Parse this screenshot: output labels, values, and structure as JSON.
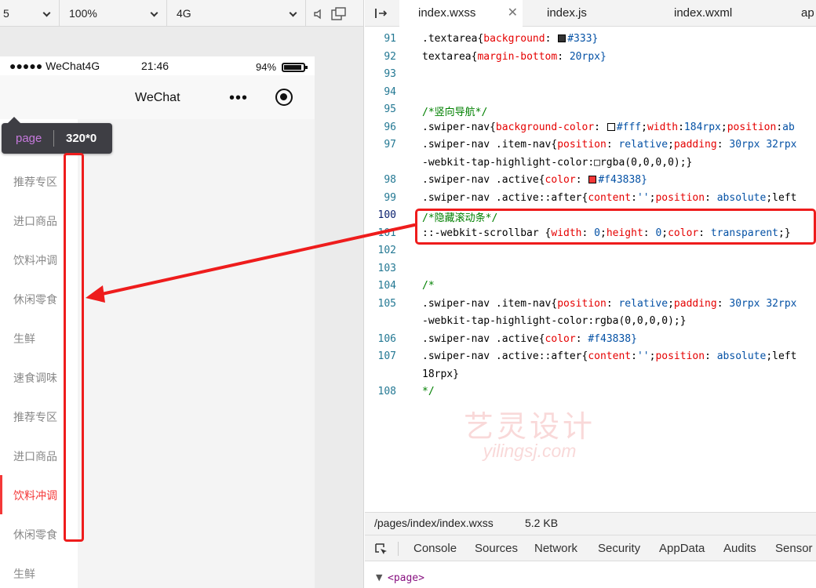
{
  "simulator": {
    "toolbar": {
      "device_value": "5",
      "zoom_value": "100%",
      "network_value": "4G"
    },
    "status_bar": {
      "carrier": "●●●●● WeChat4G",
      "time": "21:46",
      "battery": "94%"
    },
    "navbar": {
      "title": "WeChat",
      "more_glyph": "•••"
    },
    "tooltip": {
      "element": "page",
      "size": "320*0"
    },
    "sidebar": {
      "items": [
        {
          "label": "推荐专区",
          "active": false
        },
        {
          "label": "进口商品",
          "active": false
        },
        {
          "label": "饮料冲调",
          "active": false
        },
        {
          "label": "休闲零食",
          "active": false
        },
        {
          "label": "生鲜",
          "active": false
        },
        {
          "label": "速食调味",
          "active": false
        },
        {
          "label": "推荐专区",
          "active": false
        },
        {
          "label": "进口商品",
          "active": false
        },
        {
          "label": "饮料冲调",
          "active": true
        },
        {
          "label": "休闲零食",
          "active": false
        },
        {
          "label": "生鲜",
          "active": false
        }
      ],
      "active_color": "#f43838"
    }
  },
  "editor": {
    "tabs": [
      {
        "label": "index.wxss",
        "active": true,
        "closable": true
      },
      {
        "label": "index.js",
        "active": false
      },
      {
        "label": "index.wxml",
        "active": false
      },
      {
        "label": "ap",
        "active": false
      }
    ],
    "current_line": "100",
    "code_lines": [
      {
        "n": "91",
        "text": ".textarea{background: ■#333}"
      },
      {
        "n": "92",
        "text": "textarea{margin-bottom: 20rpx}"
      },
      {
        "n": "93",
        "text": ""
      },
      {
        "n": "94",
        "text": ""
      },
      {
        "n": "95",
        "text": "/*竖向导航*/"
      },
      {
        "n": "96",
        "text": ".swiper-nav{background-color: □#fff;width:184rpx;position:ab"
      },
      {
        "n": "97",
        "text": ".swiper-nav .item-nav{position: relative;padding: 30rpx 32rpx"
      },
      {
        "n": "",
        "text": "-webkit-tap-highlight-color:□rgba(0,0,0,0);}"
      },
      {
        "n": "98",
        "text": ".swiper-nav .active{color: ■#f43838}"
      },
      {
        "n": "99",
        "text": ".swiper-nav .active::after{content:'';position: absolute;left"
      },
      {
        "n": "100",
        "text": "/*隐藏滚动条*/"
      },
      {
        "n": "101",
        "text": "::-webkit-scrollbar {width: 0;height: 0;color: transparent;}"
      },
      {
        "n": "102",
        "text": ""
      },
      {
        "n": "103",
        "text": ""
      },
      {
        "n": "104",
        "text": "/*"
      },
      {
        "n": "105",
        "text": ".swiper-nav .item-nav{position: relative;padding: 30rpx 32rpx"
      },
      {
        "n": "",
        "text": "-webkit-tap-highlight-color:rgba(0,0,0,0);}"
      },
      {
        "n": "106",
        "text": ".swiper-nav .active{color: #f43838}"
      },
      {
        "n": "107",
        "text": ".swiper-nav .active::after{content:'';position: absolute;left"
      },
      {
        "n": "",
        "text": "18rpx}"
      },
      {
        "n": "108",
        "text": "*/"
      }
    ],
    "swatches": {
      "dark": "#333333",
      "white": "#ffffff",
      "red": "#f43838"
    },
    "watermark": {
      "line1": "艺灵设计",
      "line2": "yilingsj.com"
    },
    "file_info": {
      "path": "/pages/index/index.wxss",
      "size": "5.2 KB"
    },
    "devtools_tabs": [
      "Console",
      "Sources",
      "Network",
      "Security",
      "AppData",
      "Audits",
      "Sensor"
    ],
    "dom_preview": "<page>"
  },
  "annotation": {
    "color": "#ee1c1c"
  }
}
